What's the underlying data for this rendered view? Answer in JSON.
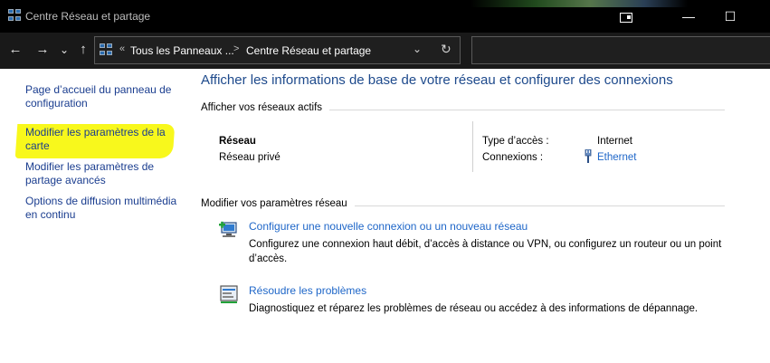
{
  "window": {
    "title": "Centre Réseau et partage",
    "minimize": "—",
    "maximize": "☐",
    "tablet_icon": "tablet-mode-icon"
  },
  "nav": {
    "back": "←",
    "forward": "→",
    "recent": "⌄",
    "up": "↑",
    "breadcrumb_sep0": "«",
    "breadcrumb_1": "Tous les Panneaux ...",
    "breadcrumb_sep1": ">",
    "breadcrumb_2": "Centre Réseau et partage",
    "dropdown": "⌄",
    "refresh": "↻"
  },
  "sidebar": {
    "items": [
      {
        "label": "Page d’accueil du panneau de configuration"
      },
      {
        "label": "Modifier les paramètres de la carte"
      },
      {
        "label": "Modifier les paramètres de partage avancés"
      },
      {
        "label": "Options de diffusion multimédia en continu"
      }
    ]
  },
  "main": {
    "heading": "Afficher les informations de base de votre réseau et configurer des connexions",
    "active_networks_title": "Afficher vos réseaux actifs",
    "network": {
      "name": "Réseau",
      "type": "Réseau privé",
      "access_label": "Type d’accès :",
      "access_value": "Internet",
      "connections_label": "Connexions :",
      "connections_value": "Ethernet"
    },
    "change_settings_title": "Modifier vos paramètres réseau",
    "tasks": [
      {
        "link": "Configurer une nouvelle connexion ou un nouveau réseau",
        "desc": "Configurez une connexion haut débit, d’accès à distance ou VPN, ou configurez un routeur ou un point d’accès."
      },
      {
        "link": "Résoudre les problèmes",
        "desc": "Diagnostiquez et réparez les problèmes de réseau ou accédez à des informations de dépannage."
      }
    ]
  },
  "colors": {
    "heading": "#1e4a8c",
    "link": "#1e66c8",
    "highlight": "#f8f81c",
    "titlebar": "#000000"
  }
}
